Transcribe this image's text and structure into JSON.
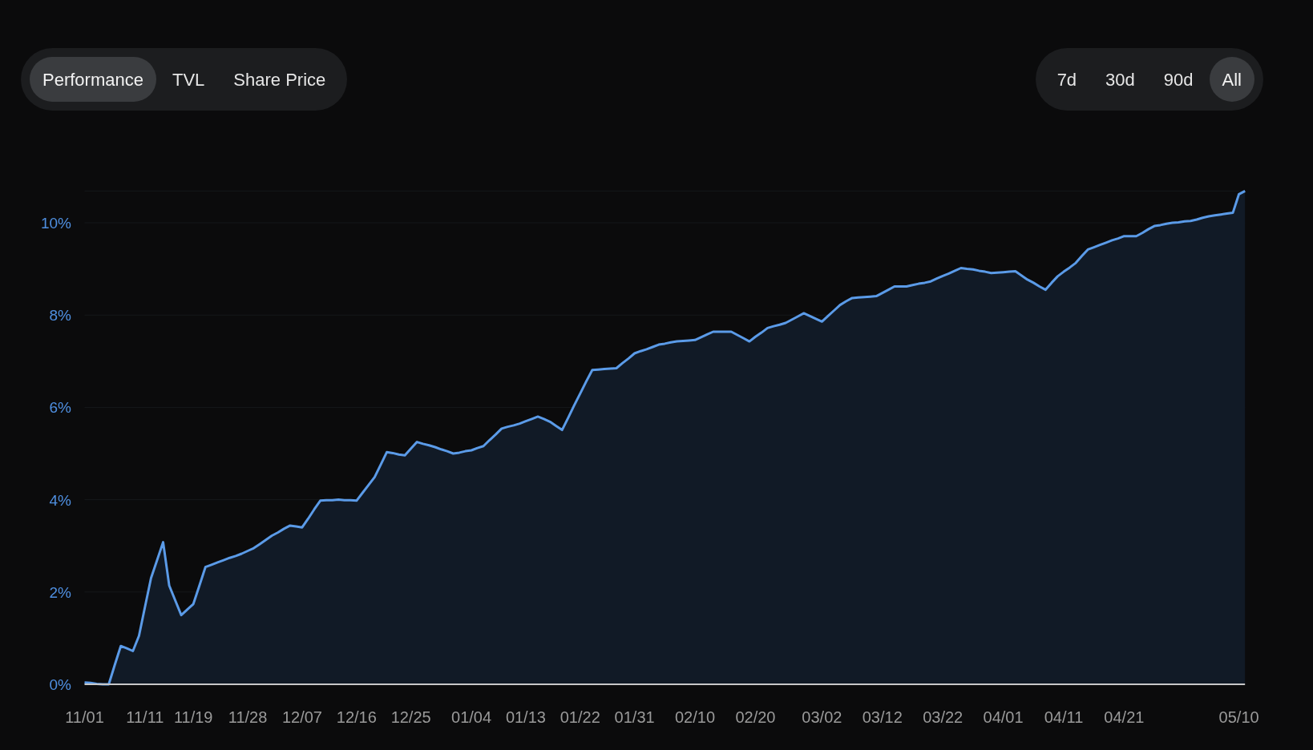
{
  "view_tabs": [
    {
      "label": "Performance",
      "selected": true
    },
    {
      "label": "TVL",
      "selected": false
    },
    {
      "label": "Share Price",
      "selected": false
    }
  ],
  "range_tabs": [
    {
      "label": "7d",
      "selected": false
    },
    {
      "label": "30d",
      "selected": false
    },
    {
      "label": "90d",
      "selected": false
    },
    {
      "label": "All",
      "selected": true
    }
  ],
  "chart": {
    "chart_data": {
      "type": "area",
      "categories": [
        "11/01",
        null,
        null,
        null,
        null,
        null,
        null,
        null,
        null,
        null,
        "11/11",
        null,
        null,
        null,
        null,
        null,
        null,
        null,
        "11/19",
        null,
        null,
        null,
        null,
        null,
        null,
        null,
        null,
        "11/28",
        null,
        null,
        null,
        null,
        null,
        null,
        null,
        null,
        "12/07",
        null,
        null,
        null,
        null,
        null,
        null,
        null,
        null,
        "12/16",
        null,
        null,
        null,
        null,
        null,
        null,
        null,
        null,
        "12/25",
        null,
        null,
        null,
        null,
        null,
        null,
        null,
        null,
        null,
        "01/04",
        null,
        null,
        null,
        null,
        null,
        null,
        null,
        null,
        "01/13",
        null,
        null,
        null,
        null,
        null,
        null,
        null,
        null,
        "01/22",
        null,
        null,
        null,
        null,
        null,
        null,
        null,
        null,
        "01/31",
        null,
        null,
        null,
        null,
        null,
        null,
        null,
        null,
        null,
        "02/10",
        null,
        null,
        null,
        null,
        null,
        null,
        null,
        null,
        null,
        "02/20",
        null,
        null,
        null,
        null,
        null,
        null,
        null,
        null,
        null,
        null,
        "03/02",
        null,
        null,
        null,
        null,
        null,
        null,
        null,
        null,
        null,
        "03/12",
        null,
        null,
        null,
        null,
        null,
        null,
        null,
        null,
        null,
        "03/22",
        null,
        null,
        null,
        null,
        null,
        null,
        null,
        null,
        null,
        "04/01",
        null,
        null,
        null,
        null,
        null,
        null,
        null,
        null,
        null,
        "04/11",
        null,
        null,
        null,
        null,
        null,
        null,
        null,
        null,
        null,
        "04/21",
        null,
        null,
        null,
        null,
        null,
        null,
        null,
        null,
        null,
        null,
        null,
        null,
        null,
        null,
        null,
        null,
        null,
        null,
        "05/10",
        null
      ],
      "series": [
        {
          "color": "#5b9be8",
          "values": [
            0.04,
            0.03,
            0.01,
            0,
            0,
            0.42,
            0.83,
            0.78,
            0.72,
            1.05,
            1.68,
            2.3,
            2.69,
            3.08,
            2.14,
            1.82,
            1.5,
            1.62,
            1.74,
            2.14,
            2.54,
            2.59,
            2.64,
            2.69,
            2.74,
            2.78,
            2.83,
            2.89,
            2.95,
            3.04,
            3.13,
            3.22,
            3.29,
            3.37,
            3.44,
            3.42,
            3.4,
            3.59,
            3.79,
            3.98,
            3.99,
            3.99,
            4.0,
            3.99,
            3.99,
            3.98,
            4.15,
            4.32,
            4.49,
            4.76,
            5.03,
            5.01,
            4.98,
            4.96,
            5.11,
            5.25,
            5.21,
            5.18,
            5.14,
            5.09,
            5.05,
            5.0,
            5.02,
            5.05,
            5.07,
            5.12,
            5.16,
            5.29,
            5.41,
            5.54,
            5.58,
            5.61,
            5.65,
            5.7,
            5.75,
            5.8,
            5.75,
            5.69,
            5.6,
            5.51,
            5.77,
            6.04,
            6.3,
            6.56,
            6.81,
            6.82,
            6.83,
            6.84,
            6.85,
            6.96,
            7.06,
            7.17,
            7.22,
            7.26,
            7.31,
            7.36,
            7.38,
            7.41,
            7.43,
            7.44,
            7.45,
            7.46,
            7.52,
            7.58,
            7.64,
            7.64,
            7.64,
            7.64,
            7.57,
            7.5,
            7.43,
            7.53,
            7.62,
            7.72,
            7.76,
            7.79,
            7.83,
            7.9,
            7.97,
            8.04,
            7.98,
            7.92,
            7.86,
            7.98,
            8.1,
            8.22,
            8.3,
            8.37,
            8.38,
            8.39,
            8.4,
            8.41,
            8.48,
            8.55,
            8.62,
            8.62,
            8.62,
            8.65,
            8.68,
            8.7,
            8.73,
            8.79,
            8.85,
            8.9,
            8.96,
            9.02,
            9.0,
            8.99,
            8.96,
            8.94,
            8.91,
            8.92,
            8.93,
            8.94,
            8.95,
            8.86,
            8.77,
            8.7,
            8.62,
            8.55,
            8.7,
            8.84,
            8.94,
            9.03,
            9.13,
            9.28,
            9.42,
            9.47,
            9.52,
            9.57,
            9.62,
            9.66,
            9.71,
            9.71,
            9.71,
            9.78,
            9.86,
            9.93,
            9.95,
            9.98,
            10.0,
            10.01,
            10.03,
            10.04,
            10.07,
            10.11,
            10.14,
            10.16,
            10.18,
            10.2,
            10.22,
            10.62,
            10.69
          ]
        }
      ],
      "grid": true,
      "ylim": [
        0,
        10.69
      ],
      "yticks": [
        {
          "value": 0,
          "label": "0%"
        },
        {
          "value": 2,
          "label": "2%"
        },
        {
          "value": 4,
          "label": "4%"
        },
        {
          "value": 6,
          "label": "6%"
        },
        {
          "value": 8,
          "label": "8%"
        },
        {
          "value": 10,
          "label": "10%"
        }
      ]
    }
  }
}
